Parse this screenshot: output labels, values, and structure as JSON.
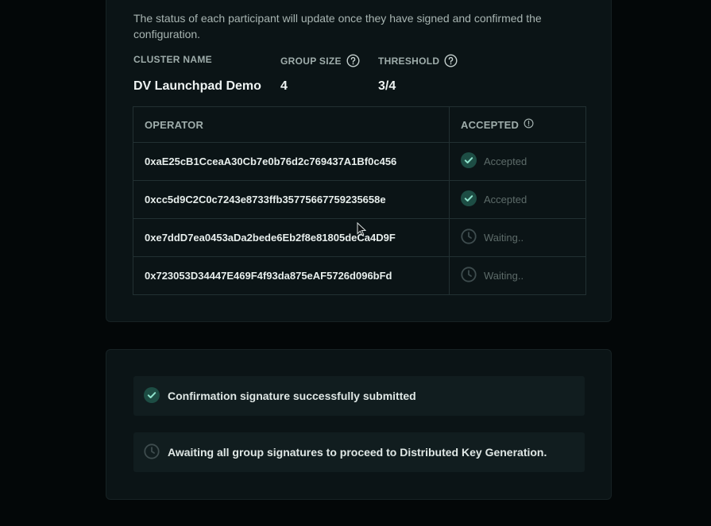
{
  "intro_text": "The status of each participant will update once they have signed and confirmed the configuration.",
  "meta": {
    "cluster_name_label": "CLUSTER NAME",
    "cluster_name_value": "DV Launchpad Demo",
    "group_size_label": "GROUP SIZE",
    "group_size_value": "4",
    "threshold_label": "THRESHOLD",
    "threshold_value": "3/4"
  },
  "table": {
    "columns": [
      "OPERATOR",
      "ACCEPTED"
    ],
    "rows": [
      {
        "operator": "0xaE25cB1CceaA30Cb7e0b76d2c769437A1Bf0c456",
        "status": "Accepted",
        "status_icon": "check-circle-icon"
      },
      {
        "operator": "0xcc5d9C2C0c7243e8733ffb35775667759235658e",
        "status": "Accepted",
        "status_icon": "check-circle-icon"
      },
      {
        "operator": "0xe7ddD7ea0453aDa2bede6Eb2f8e81805deCa4D9F",
        "status": "Waiting..",
        "status_icon": "clock-icon"
      },
      {
        "operator": "0x723053D34447E469F4f93da875eAF5726d096bFd",
        "status": "Waiting..",
        "status_icon": "clock-icon"
      }
    ]
  },
  "notices": [
    {
      "text": "Confirmation signature successfully submitted",
      "icon": "check-circle-icon"
    },
    {
      "text": "Awaiting all group signatures to proceed to Distributed Key Generation.",
      "icon": "clock-icon"
    }
  ],
  "colors": {
    "accent_green": "#2c8f79",
    "card_bg": "#0b1416",
    "page_bg": "#030708"
  }
}
